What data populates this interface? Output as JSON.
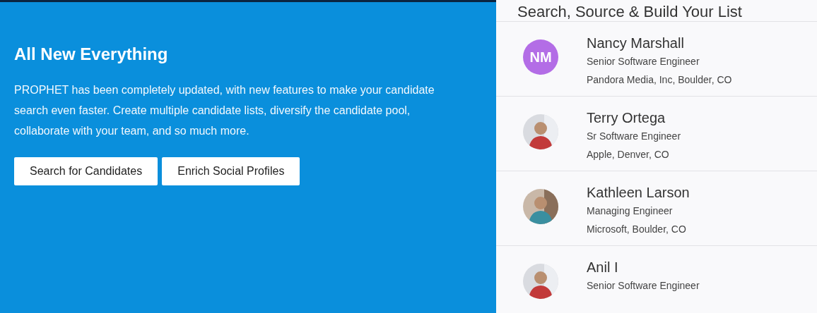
{
  "promo": {
    "title": "All New Everything",
    "body": "PROPHET has been completely updated, with new features to make your candidate search even faster. Create multiple candidate lists, diversify the candidate pool, collaborate with your team, and so much more.",
    "buttons": [
      "Search for Candidates",
      "Enrich Social Profiles"
    ]
  },
  "list": {
    "title": "Search, Source & Build Your List",
    "candidates": [
      {
        "name": "Nancy Marshall",
        "role": "Senior Software Engineer",
        "company": "Pandora Media, Inc, Boulder, CO",
        "avatar": {
          "kind": "initials",
          "text": "NM",
          "color": "#b36de6"
        }
      },
      {
        "name": "Terry Ortega",
        "role": "Sr Software Engineer",
        "company": "Apple, Denver, CO"
      },
      {
        "name": "Kathleen Larson",
        "role": "Managing Engineer",
        "company": "Microsoft, Boulder, CO"
      },
      {
        "name": "Anil I",
        "role": "Senior Software Engineer"
      }
    ]
  }
}
